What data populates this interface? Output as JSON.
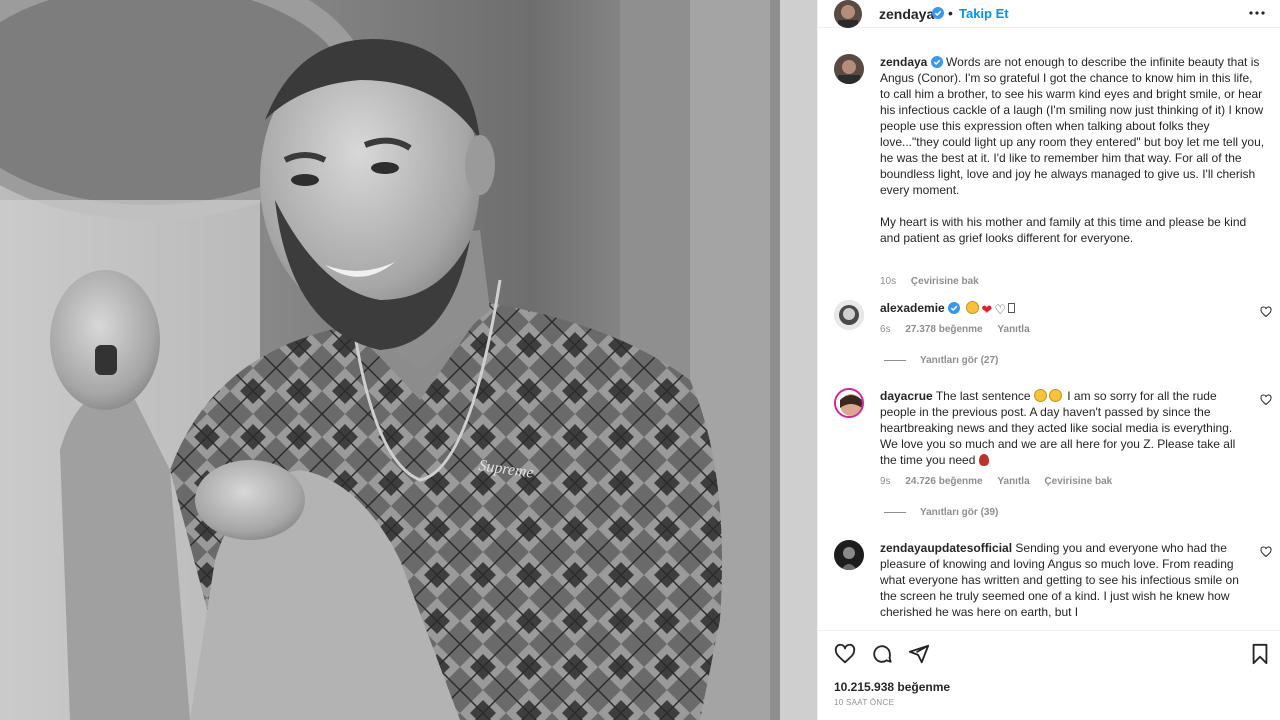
{
  "post": {
    "author": "zendaya",
    "follow_label": "Takip Et",
    "dot": "•",
    "more": "...",
    "caption_p1": "Words are not enough to describe the infinite beauty that is Angus (Conor). I'm so grateful I got the chance to know him in this life, to call him a brother, to see his warm kind eyes and bright smile, or hear his infectious cackle of a laugh (I'm smiling now just thinking of it) I know people use this expression often when talking about folks they love...\"they could light up any room they entered\" but boy let me tell you, he was the best at it. I'd like to remember him that way. For all of the boundless light, love and joy he always managed to give us. I'll cherish every moment.",
    "caption_p2": "My heart is with his mother and family at this time and please be kind and patient as grief looks different for everyone.",
    "caption_time": "10s",
    "caption_translate": "Çevirisine bak",
    "likes": "10.215.938 beğenme",
    "posted_ago": "10 SAAT ÖNCE",
    "photo_logo_text": "Supreme"
  },
  "comments": [
    {
      "user": "alexademie",
      "time": "6s",
      "likes": "27.378 beğenme",
      "reply": "Yanıtla",
      "view_replies": "Yanıtları gör (27)"
    },
    {
      "user": "dayacrue",
      "text_a": "The last sentence",
      "text_b": "I am so sorry for all the rude people in the previous post. A day haven't passed by since the heartbreaking news and they acted like social media is everything. We love you so much and we are all here for you Z. Please take all the time you need",
      "time": "9s",
      "likes": "24.726 beğenme",
      "reply": "Yanıtla",
      "translate": "Çevirisine bak",
      "view_replies": "Yanıtları gör (39)"
    },
    {
      "user": "zendayaupdatesofficial",
      "text": "Sending you and everyone who had the pleasure of knowing and loving Angus so much love. From reading what everyone has written and getting to see his infectious smile on the screen he truly seemed one of a kind. I just wish he knew how cherished he was here on earth, but I"
    }
  ],
  "icons": {
    "like": "heart-icon",
    "comment": "comment-icon",
    "share": "share-icon",
    "save": "bookmark-icon",
    "verified": "verified-badge-icon",
    "more": "more-options-icon"
  },
  "colors": {
    "link": "#0095f6",
    "verified": "#3897f0",
    "muted": "#8e8e8e",
    "text": "#262626"
  }
}
